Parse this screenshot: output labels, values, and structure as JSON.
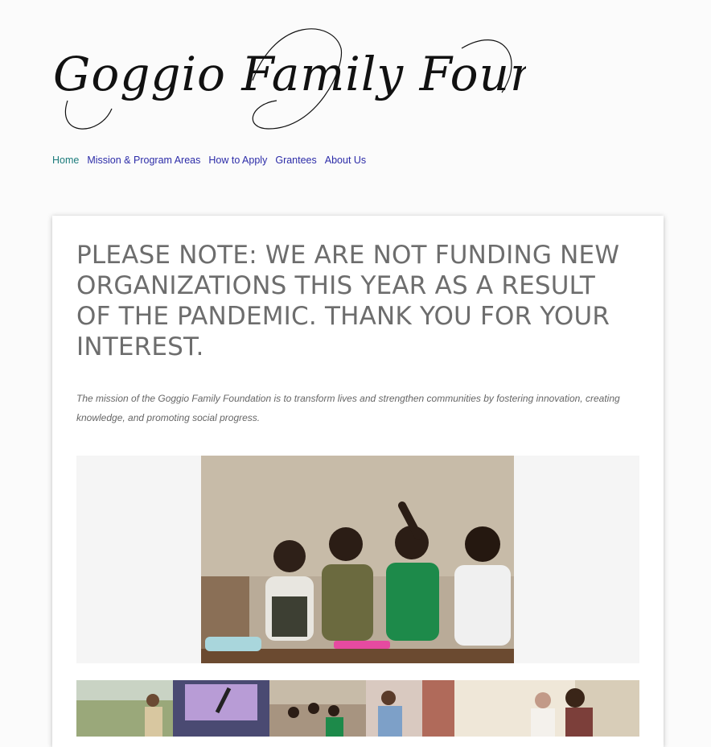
{
  "site": {
    "logo_text": "Goggio Family Foundation"
  },
  "nav": {
    "items": [
      {
        "label": "Home",
        "active": true
      },
      {
        "label": "Mission & Program Areas",
        "active": false
      },
      {
        "label": "How to Apply",
        "active": false
      },
      {
        "label": "Grantees",
        "active": false
      },
      {
        "label": "About Us",
        "active": false
      }
    ]
  },
  "main": {
    "headline": "PLEASE NOTE: WE ARE NOT FUNDING NEW ORGANIZATIONS THIS YEAR AS A RESULT OF THE PANDEMIC. THANK YOU FOR YOUR INTEREST.",
    "mission": "The mission of the Goggio Family Foundation is to transform lives and strengthen communities by fostering innovation, creating knowledge, and promoting social progress."
  },
  "gallery": {
    "hero_description": "schoolchildren-classroom-photo",
    "thumbnails": [
      "garden-photo",
      "presentation-photo",
      "classroom-photo",
      "medical-photo",
      "mother-baby-photo"
    ]
  }
}
